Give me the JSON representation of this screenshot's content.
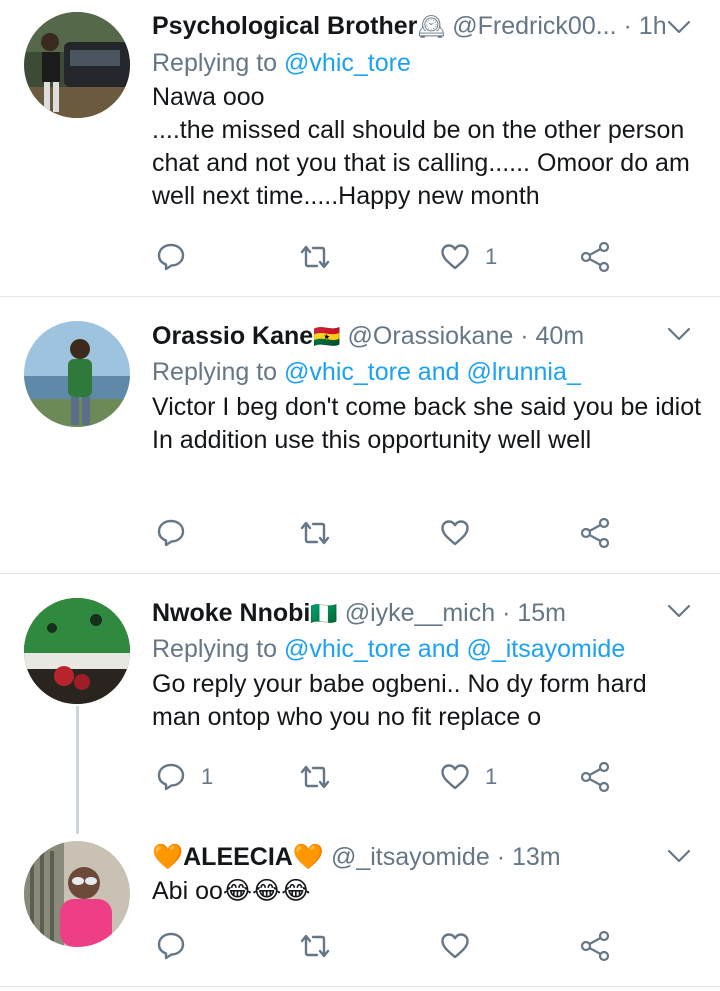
{
  "tweets": [
    {
      "name": "Psychological Brother",
      "name_suffix": "🕰",
      "handle": "@Fredrick00...",
      "time": "· 1h",
      "replying_prefix": "Replying to",
      "replying_to": "@vhic_tore",
      "text": "Nawa ooo\n....the missed call should be on the other person chat and not you that is calling...... Omoor do am well next time.....Happy new month",
      "replies": "",
      "retweets": "",
      "likes": "1"
    },
    {
      "name": "Orassio Kane",
      "name_suffix": "🇬🇭",
      "handle": "@Orassiokane",
      "time": "· 40m",
      "replying_prefix": "Replying to",
      "replying_to": "@vhic_tore and @lrunnia_",
      "text": "Victor I beg don't  come back she said you be idiot\nIn addition  use this opportunity well well",
      "replies": "",
      "retweets": "",
      "likes": ""
    },
    {
      "name": "Nwoke Nnobi",
      "name_suffix": "🇳🇬",
      "handle": "@iyke__mich",
      "time": "· 15m",
      "replying_prefix": "Replying to",
      "replying_to": "@vhic_tore and @_itsayomide",
      "text": "Go reply your babe ogbeni.. No dy form hard man ontop who you no fit replace o",
      "replies": "1",
      "retweets": "",
      "likes": "1"
    },
    {
      "name": "🧡ALEECIA🧡",
      "name_suffix": "",
      "handle": "@_itsayomide",
      "time": "· 13m",
      "text": "Abi oo😂😂😂",
      "replies": "",
      "retweets": "",
      "likes": ""
    }
  ],
  "icons": {
    "reply": "reply-icon",
    "retweet": "retweet-icon",
    "like": "heart-icon",
    "share": "share-icon",
    "more": "chevron-down-icon"
  },
  "colors": {
    "text": "#14171a",
    "secondary": "#657786",
    "link": "#1da1f2",
    "divider": "#e1e8ed",
    "icon": "#657786"
  }
}
